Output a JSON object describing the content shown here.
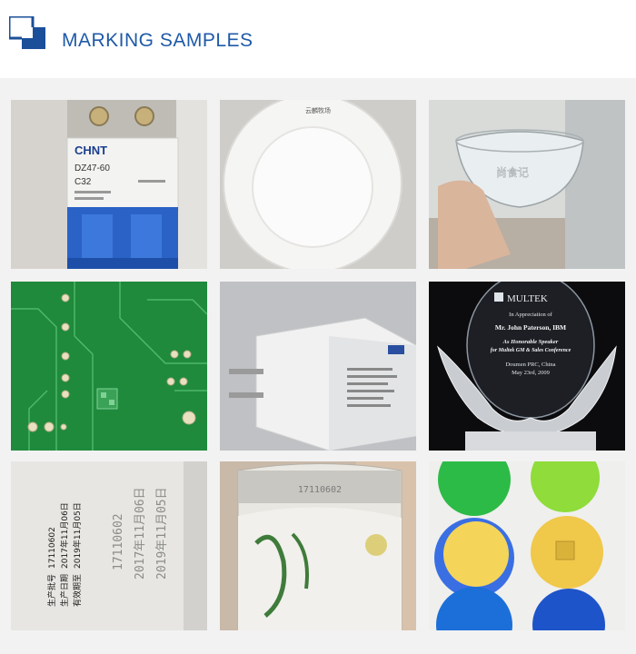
{
  "header": {
    "title": "MARKING SAMPLES"
  },
  "samples": {
    "breaker": {
      "brand": "CHNT",
      "model": "DZ47-60",
      "rating": "C32"
    },
    "plate": {
      "mark": "云麟牧场"
    },
    "bowl": {
      "mark": "尚食记"
    },
    "trophy": {
      "brand": "MULTEK",
      "line1": "In Appreciation of",
      "line2": "Mr. John Paterson, IBM",
      "line3": "As Honorable Speaker",
      "line4": "for Multek GM & Sales Conference",
      "line5": "Doumen PRC, China",
      "line6": "May 23rd, 2009"
    },
    "printed_dates": {
      "batch": "17110602",
      "prod_date": "2017年11月06日",
      "exp_date": "2019年11月05日",
      "label_batch": "生产批号",
      "label_prod": "生产日期",
      "label_exp": "有效期至"
    },
    "can": {
      "code": "17110602"
    }
  },
  "colors": {
    "title": "#1f5aa8",
    "logo_dark": "#1b4f99",
    "logo_light": "#4c8fd6",
    "pcb_green": "#1f8a3c"
  }
}
